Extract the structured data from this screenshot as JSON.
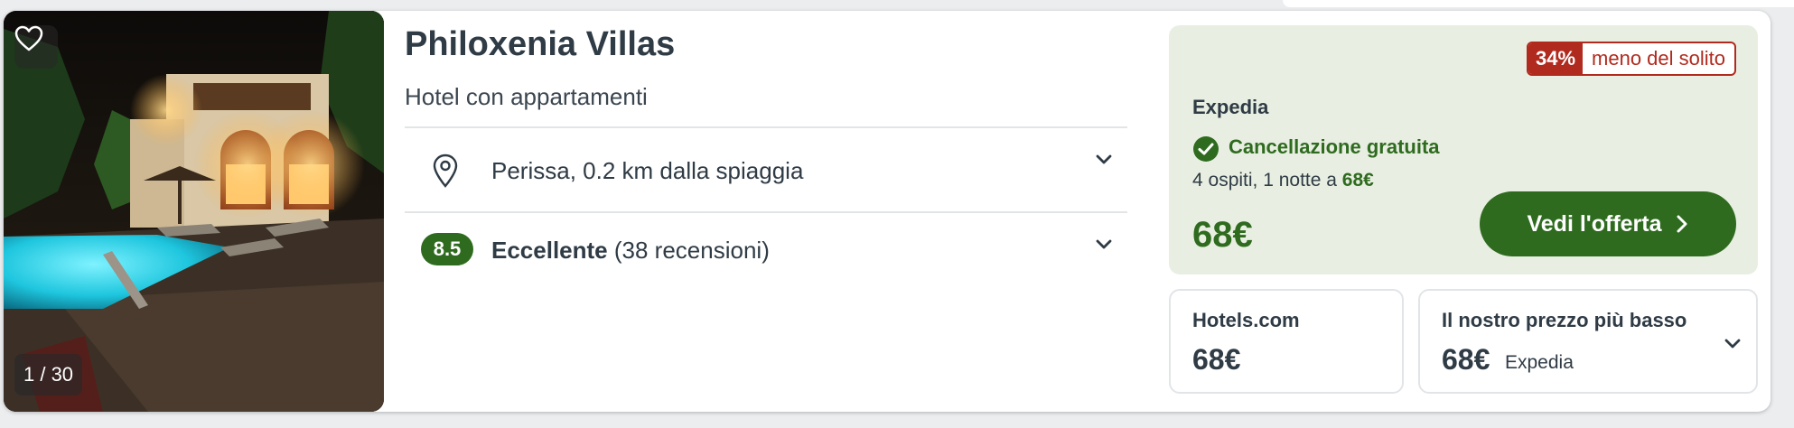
{
  "hotel": {
    "name": "Philoxenia Villas",
    "type": "Hotel con appartamenti",
    "photo_counter": "1 / 30",
    "location": "Perissa, 0.2 km dalla spiaggia",
    "rating": {
      "score": "8.5",
      "label": "Eccellente",
      "reviews": "(38 recensioni)"
    }
  },
  "offer": {
    "discount_pct": "34%",
    "discount_text": "meno del solito",
    "provider": "Expedia",
    "cancellation": "Cancellazione gratuita",
    "guests_text": "4 ospiti, 1 notte a",
    "guests_price": "68€",
    "price": "68€",
    "cta_label": "Vedi l'offerta"
  },
  "alternatives": [
    {
      "title": "Hotels.com",
      "price": "68€"
    },
    {
      "title": "Il nostro prezzo più basso",
      "price": "68€",
      "provider": "Expedia"
    }
  ],
  "colors": {
    "accent_green": "#2f6b1f",
    "deal_red": "#b02a1e",
    "offer_bg": "#e8efe2",
    "text_dark": "#2f3b45"
  },
  "icons": [
    "heart-icon",
    "location-pin-icon",
    "chevron-down-icon",
    "check-circle-icon",
    "chevron-right-icon"
  ]
}
